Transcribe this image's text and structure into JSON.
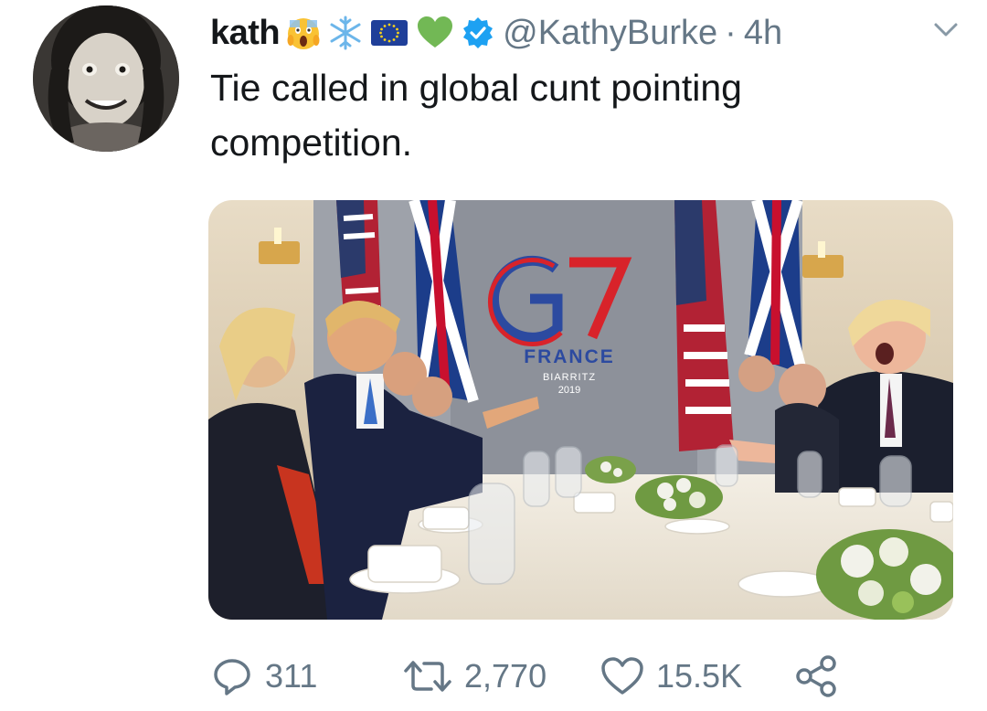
{
  "author": {
    "display_name": "kath",
    "emoji": [
      "scream-emoji",
      "snowflake-emoji",
      "eu-flag-emoji",
      "green-heart-emoji"
    ],
    "verified": true,
    "handle": "@KathyBurke",
    "separator": "·",
    "time": "4h"
  },
  "tweet": {
    "text": "Tie called in global cunt pointing competition."
  },
  "media": {
    "backdrop": {
      "logo": "G7",
      "country": "FRANCE",
      "city": "BIARRITZ",
      "year": "2019"
    }
  },
  "actions": {
    "reply_count": "311",
    "retweet_count": "2,770",
    "like_count": "15.5K"
  },
  "colors": {
    "text": "#14171a",
    "secondary": "#657786",
    "verified": "#1da1f2"
  }
}
